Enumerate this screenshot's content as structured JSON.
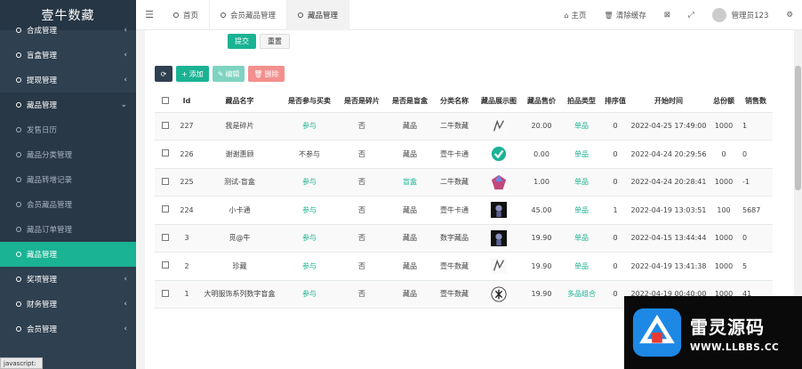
{
  "brand": "壹牛数藏",
  "sidebar": {
    "items": [
      {
        "label": "合成管理",
        "chevron": "‹",
        "type": "main"
      },
      {
        "label": "盲盒管理",
        "chevron": "‹",
        "type": "main"
      },
      {
        "label": "提现管理",
        "chevron": "‹",
        "type": "main"
      },
      {
        "label": "藏品管理",
        "chevron": "⌄",
        "type": "open"
      },
      {
        "label": "发售日历",
        "chevron": "",
        "type": "sub"
      },
      {
        "label": "藏品分类管理",
        "chevron": "",
        "type": "sub"
      },
      {
        "label": "藏品转增记录",
        "chevron": "",
        "type": "sub"
      },
      {
        "label": "会员藏品管理",
        "chevron": "",
        "type": "sub"
      },
      {
        "label": "藏品订单管理",
        "chevron": "",
        "type": "sub"
      },
      {
        "label": "藏品管理",
        "chevron": "",
        "type": "active"
      },
      {
        "label": "奖项管理",
        "chevron": "‹",
        "type": "main"
      },
      {
        "label": "财务管理",
        "chevron": "‹",
        "type": "main"
      },
      {
        "label": "会员管理",
        "chevron": "‹",
        "type": "main"
      }
    ]
  },
  "status_text": "javascript:",
  "topbar": {
    "tabs": [
      {
        "label": "首页",
        "active": false
      },
      {
        "label": "会员藏品管理",
        "active": false
      },
      {
        "label": "藏品管理",
        "active": true
      }
    ],
    "home": "主页",
    "clear_cache": "清除缓存",
    "user": "管理员123"
  },
  "form": {
    "submit": "提交",
    "reset": "重置"
  },
  "toolbar": {
    "add": "添加",
    "edit": "编辑",
    "delete": "删除"
  },
  "table": {
    "headers": [
      "",
      "Id",
      "藏品名字",
      "是否参与买卖",
      "是否是碎片",
      "是否是盲盒",
      "分类名称",
      "藏品展示图",
      "藏品售价",
      "拍品类型",
      "排序值",
      "开始时间",
      "总份额",
      "销售数"
    ],
    "rows": [
      {
        "id": "227",
        "name": "我是碎片",
        "trade": "参与",
        "trade_green": true,
        "fragment": "否",
        "box": "藏品",
        "box_green": false,
        "category": "二牛数藏",
        "img": "scratch",
        "price": "20.00",
        "ptype": "单品",
        "ptype_green": true,
        "sort": "0",
        "start": "2022-04-25 17:49:00",
        "total": "1000",
        "sold": "1"
      },
      {
        "id": "226",
        "name": "谢谢惠顾",
        "trade": "不参与",
        "trade_green": false,
        "fragment": "否",
        "box": "藏品",
        "box_green": false,
        "category": "壹牛卡通",
        "img": "check",
        "price": "0.00",
        "ptype": "单品",
        "ptype_green": true,
        "sort": "0",
        "start": "2022-04-24 20:29:56",
        "total": "0",
        "sold": "0"
      },
      {
        "id": "225",
        "name": "测试-盲盒",
        "trade": "参与",
        "trade_green": true,
        "fragment": "否",
        "box": "盲盒",
        "box_green": true,
        "category": "二牛数藏",
        "img": "gem",
        "price": "1.00",
        "ptype": "单品",
        "ptype_green": true,
        "sort": "0",
        "start": "2022-04-24 20:28:41",
        "total": "1000",
        "sold": "-1"
      },
      {
        "id": "224",
        "name": "小卡通",
        "trade": "参与",
        "trade_green": true,
        "fragment": "否",
        "box": "藏品",
        "box_green": false,
        "category": "壹牛卡通",
        "img": "dark",
        "price": "45.00",
        "ptype": "单品",
        "ptype_green": true,
        "sort": "1",
        "start": "2022-04-19 13:03:51",
        "total": "100",
        "sold": "5687"
      },
      {
        "id": "3",
        "name": "觅@牛",
        "trade": "参与",
        "trade_green": true,
        "fragment": "否",
        "box": "藏品",
        "box_green": false,
        "category": "数字藏品",
        "img": "dark",
        "price": "19.90",
        "ptype": "单品",
        "ptype_green": true,
        "sort": "0",
        "start": "2022-04-15 13:44:44",
        "total": "1000",
        "sold": "0"
      },
      {
        "id": "2",
        "name": "珍藏",
        "trade": "参与",
        "trade_green": true,
        "fragment": "否",
        "box": "藏品",
        "box_green": false,
        "category": "壹牛数藏",
        "img": "scratch",
        "price": "19.90",
        "ptype": "单品",
        "ptype_green": true,
        "sort": "0",
        "start": "2022-04-19 13:41:38",
        "total": "1000",
        "sold": "5"
      },
      {
        "id": "1",
        "name": "大明服饰系列数字盲盒",
        "trade": "参与",
        "trade_green": true,
        "fragment": "否",
        "box": "藏品",
        "box_green": false,
        "category": "壹牛数藏",
        "img": "seal",
        "price": "19.90",
        "ptype": "多品组合",
        "ptype_green": true,
        "sort": "0",
        "start": "2022-04-19 00:40:00",
        "total": "1000",
        "sold": "41"
      }
    ]
  },
  "watermark": {
    "title": "雷灵源码",
    "url": "WWW.LLBBS.CC"
  },
  "colors": {
    "sidebar": "#2f4050",
    "accent": "#1ab394",
    "edit": "#7fd3c1",
    "delete": "#f3908d"
  }
}
